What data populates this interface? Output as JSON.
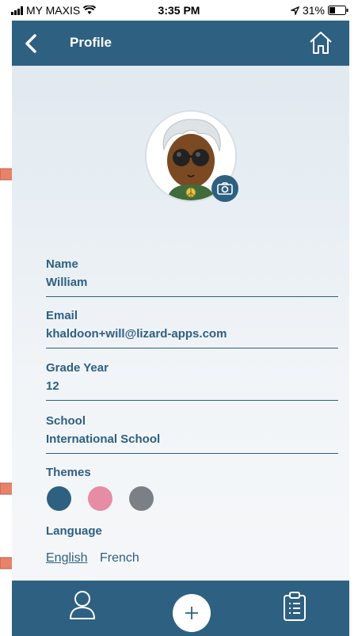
{
  "status_bar": {
    "carrier": "MY MAXIS",
    "time": "3:35 PM",
    "battery": "31%"
  },
  "navbar": {
    "title": "Profile"
  },
  "profile": {
    "name_label": "Name",
    "name_value": "William",
    "email_label": "Email",
    "email_value": "khaldoon+will@lizard-apps.com",
    "grade_label": "Grade Year",
    "grade_value": "12",
    "school_label": "School",
    "school_value": "International School"
  },
  "themes": {
    "label": "Themes",
    "colors": [
      "#2e6082",
      "#e68ca5",
      "#7b8087"
    ]
  },
  "language": {
    "label": "Language",
    "options": [
      "English",
      "French"
    ],
    "selected": "English"
  },
  "icons": {
    "back": "chevron-left-icon",
    "home": "home-icon",
    "camera": "camera-icon",
    "profile_tab": "user-icon",
    "add": "plus-icon",
    "list_tab": "clipboard-icon"
  },
  "colors": {
    "brand": "#2e6082",
    "arrow": "#e8836a"
  }
}
